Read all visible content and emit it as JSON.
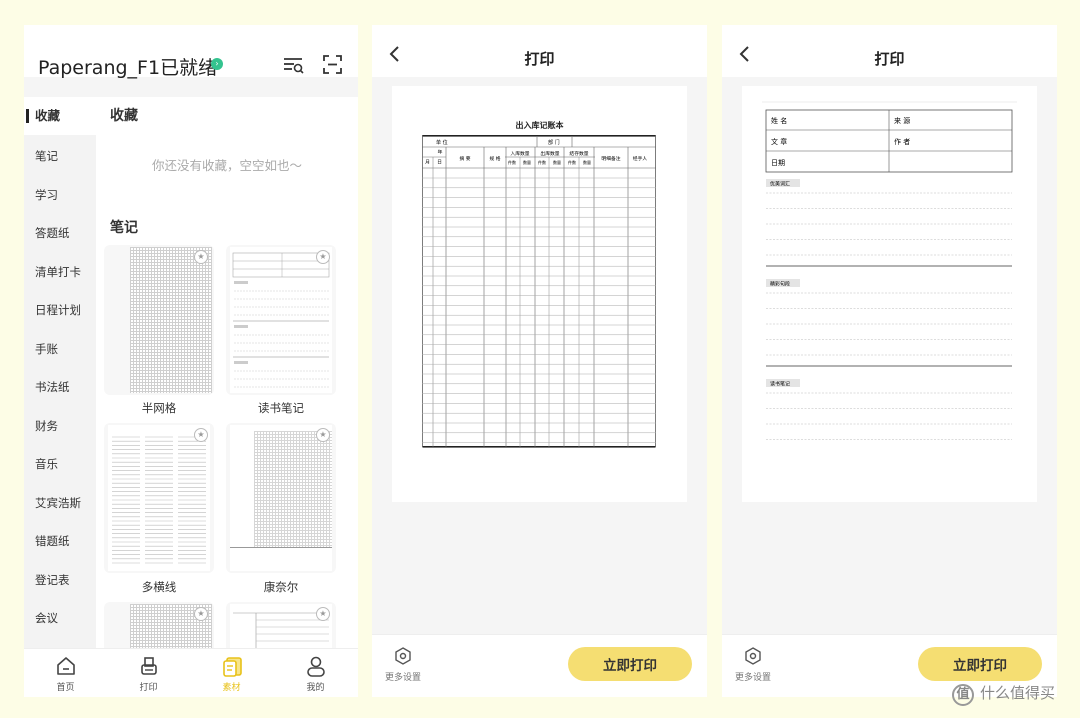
{
  "screen1": {
    "header": {
      "title": "Paperang_F1已就绪",
      "status_icon": "check-circle-icon",
      "status_color": "#34c38f"
    },
    "sidebar": {
      "items": [
        {
          "label": "收藏",
          "active": true
        },
        {
          "label": "笔记"
        },
        {
          "label": "学习"
        },
        {
          "label": "答题纸"
        },
        {
          "label": "清单打卡"
        },
        {
          "label": "日程计划"
        },
        {
          "label": "手账"
        },
        {
          "label": "书法纸"
        },
        {
          "label": "财务"
        },
        {
          "label": "音乐"
        },
        {
          "label": "艾宾浩斯"
        },
        {
          "label": "错题纸"
        },
        {
          "label": "登记表"
        },
        {
          "label": "会议"
        }
      ]
    },
    "favorites": {
      "title": "收藏",
      "empty_text": "你还没有收藏，空空如也～"
    },
    "notes": {
      "title": "笔记",
      "cards": [
        {
          "label": "半网格"
        },
        {
          "label": "读书笔记"
        },
        {
          "label": "多横线"
        },
        {
          "label": "康奈尔"
        }
      ]
    },
    "tabbar": {
      "tabs": [
        {
          "label": "首页",
          "icon": "home-icon"
        },
        {
          "label": "打印",
          "icon": "printer-icon"
        },
        {
          "label": "素材",
          "icon": "material-icon",
          "active": true
        },
        {
          "label": "我的",
          "icon": "user-icon"
        }
      ],
      "active_color": "#e8c21a"
    }
  },
  "screen2": {
    "title": "打印",
    "doc": {
      "title": "出入库记账本",
      "row1": [
        "单 位",
        "部 门"
      ],
      "headers": [
        "年",
        "月",
        "日",
        "摘 要",
        "规 格",
        "入库数量",
        "出库数量",
        "结存数量",
        "明细备注",
        "经手人"
      ],
      "sub_headers": [
        "件数",
        "数量",
        "件数",
        "数量",
        "件数",
        "数量"
      ]
    },
    "more_label": "更多设置",
    "print_label": "立即打印"
  },
  "screen3": {
    "title": "打印",
    "doc": {
      "fields": [
        "姓 名",
        "来 源",
        "文 章",
        "作 者",
        "日期"
      ],
      "sections": [
        "优美词汇",
        "精彩句段",
        "读书笔记"
      ]
    },
    "more_label": "更多设置",
    "print_label": "立即打印"
  },
  "watermark": {
    "text": "什么值得买",
    "badge": "值"
  },
  "colors": {
    "accent": "#f5de72",
    "background": "#fdfde6"
  }
}
